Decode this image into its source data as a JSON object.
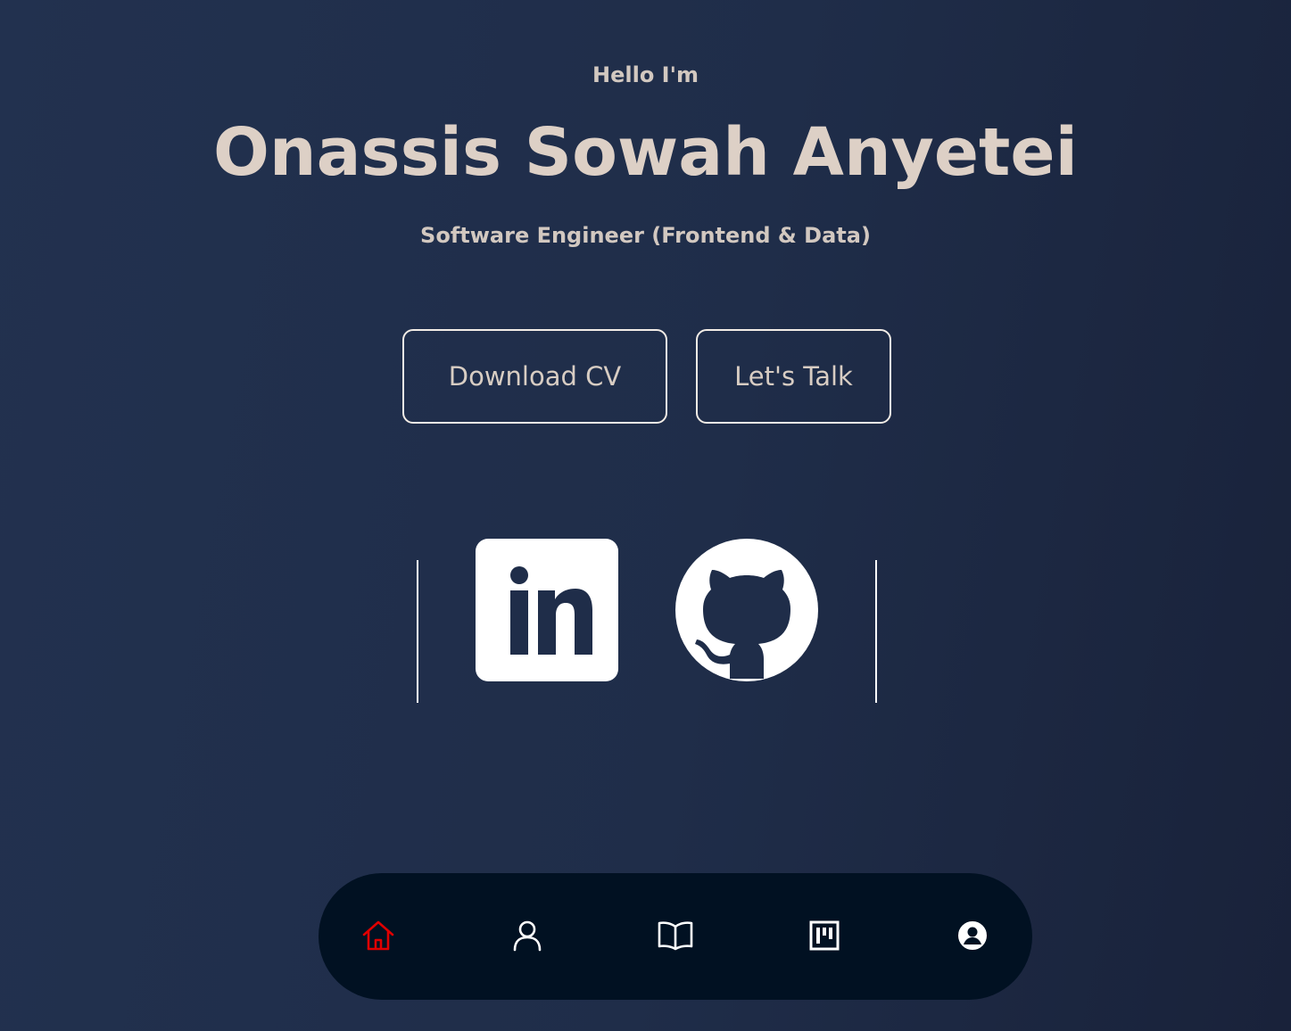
{
  "hero": {
    "greeting": "Hello I'm",
    "name": "Onassis Sowah Anyetei",
    "role": "Software Engineer (Frontend & Data)"
  },
  "actions": {
    "download_cv_label": "Download CV",
    "lets_talk_label": "Let's Talk"
  },
  "social": {
    "linkedin": "linkedin-icon",
    "github": "github-icon"
  },
  "bottom_nav": {
    "items": [
      {
        "icon": "home-icon",
        "active": true
      },
      {
        "icon": "user-icon",
        "active": false
      },
      {
        "icon": "book-icon",
        "active": false
      },
      {
        "icon": "kanban-icon",
        "active": false
      },
      {
        "icon": "profile-circle-icon",
        "active": false
      }
    ],
    "active_color": "#e00000",
    "inactive_color": "#ffffff"
  },
  "colors": {
    "background_start": "#22314f",
    "background_end": "#19223a",
    "text": "#d8cdc3",
    "nav_background": "#011122"
  }
}
